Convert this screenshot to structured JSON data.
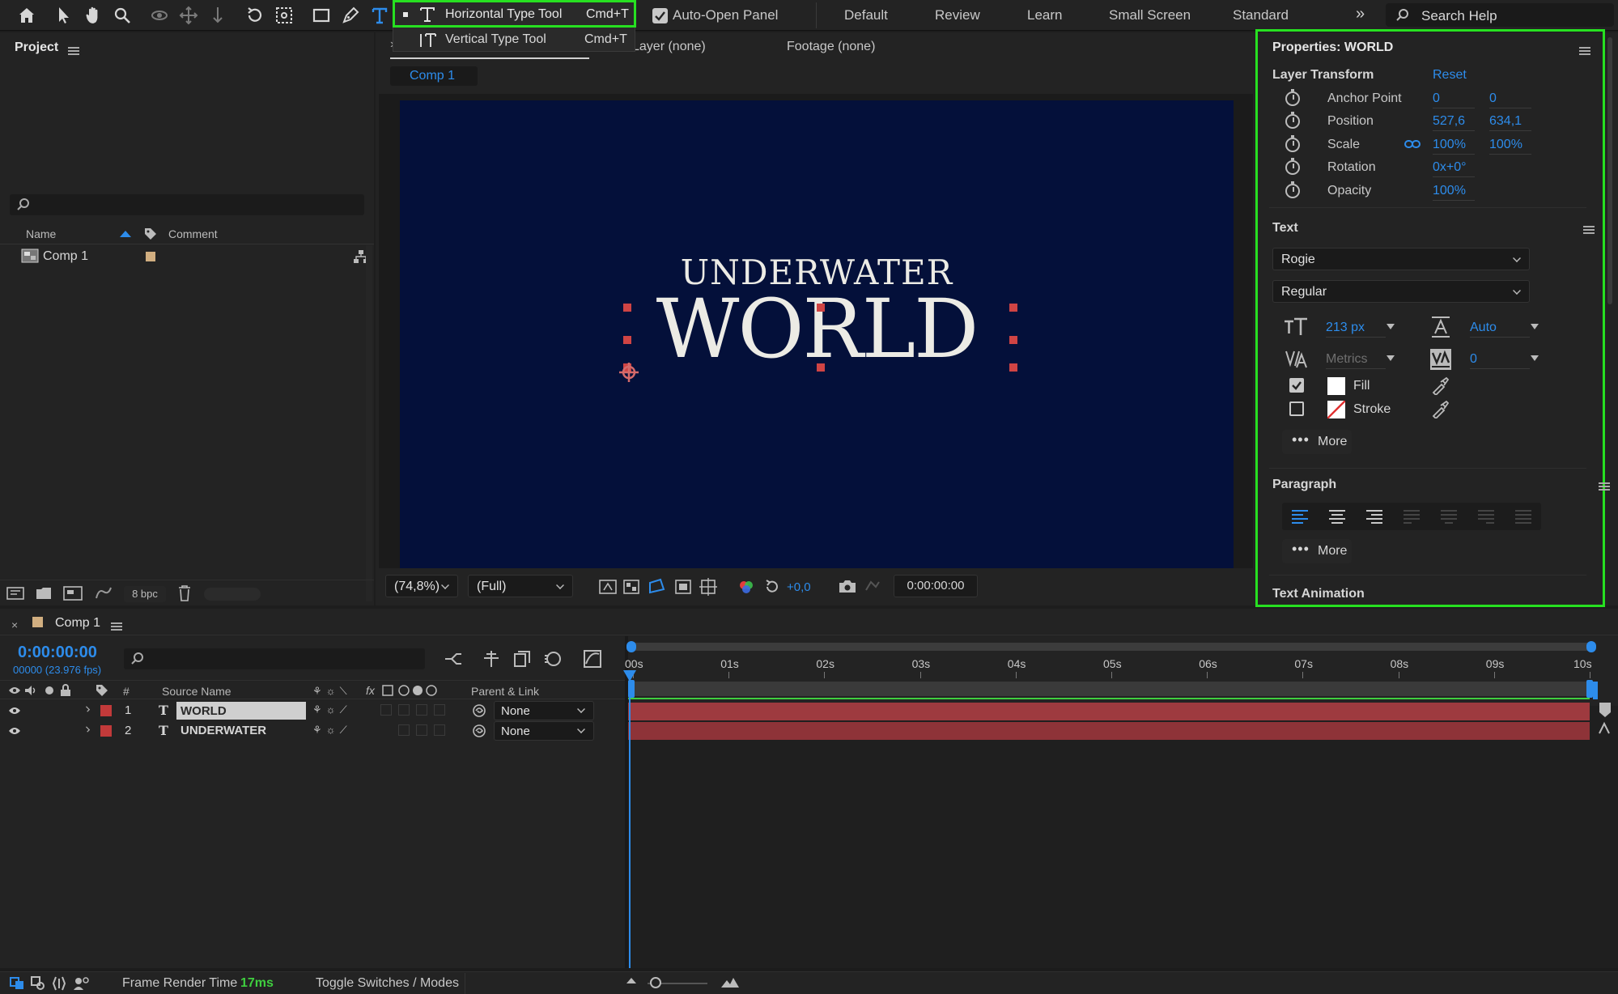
{
  "toolbar": {
    "tools": [
      "home-icon",
      "selection-icon",
      "hand-icon",
      "zoom-icon",
      "orbit-icon",
      "pan-icon",
      "dolly-icon",
      "rotate-icon",
      "anchor-icon",
      "rectangle-icon",
      "pen-icon",
      "type-icon"
    ],
    "auto_open_label": "Auto-Open Panel",
    "workspaces": [
      "Default",
      "Review",
      "Learn",
      "Small Screen",
      "Standard"
    ],
    "search_placeholder": "Search Help"
  },
  "type_menu": {
    "horizontal_label": "Horizontal Type Tool",
    "horizontal_shortcut": "Cmd+T",
    "vertical_label": "Vertical Type Tool",
    "vertical_shortcut": "Cmd+T"
  },
  "project": {
    "title": "Project",
    "col_name": "Name",
    "col_comment": "Comment",
    "items": [
      {
        "name": "Comp 1"
      }
    ],
    "bpc_label": "8 bpc"
  },
  "viewer": {
    "tab_layer": "Layer (none)",
    "tab_footage": "Footage (none)",
    "comp_tab": "Comp 1",
    "canvas_line1": "UNDERWATER",
    "canvas_line2": "WORLD",
    "zoom": "(74,8%)",
    "resolution": "(Full)",
    "exposure": "+0,0",
    "timecode": "0:00:00:00"
  },
  "properties": {
    "title": "Properties: WORLD",
    "layer_transform": "Layer Transform",
    "reset": "Reset",
    "rows": [
      {
        "label": "Anchor Point",
        "v1": "0",
        "v2": "0"
      },
      {
        "label": "Position",
        "v1": "527,6",
        "v2": "634,1"
      },
      {
        "label": "Scale",
        "v1": "100%",
        "v2": "100%"
      },
      {
        "label": "Rotation",
        "v1": "0x+0°",
        "v2": ""
      },
      {
        "label": "Opacity",
        "v1": "100%",
        "v2": ""
      }
    ],
    "text_section": "Text",
    "font_family": "Rogie",
    "font_style": "Regular",
    "font_size": "213 px",
    "leading": "Auto",
    "kerning": "Metrics",
    "tracking": "0",
    "fill_label": "Fill",
    "stroke_label": "Stroke",
    "more_label": "More",
    "paragraph_section": "Paragraph",
    "para_more_label": "More",
    "text_animation": "Text Animation"
  },
  "timeline": {
    "comp_name": "Comp 1",
    "timecode": "0:00:00:00",
    "fps": "00000 (23.976 fps)",
    "col_hash": "#",
    "col_source": "Source Name",
    "col_parent": "Parent & Link",
    "layers": [
      {
        "num": "1",
        "name": "WORLD",
        "parent": "None"
      },
      {
        "num": "2",
        "name": "UNDERWATER",
        "parent": "None"
      }
    ],
    "ruler": [
      "00s",
      "01s",
      "02s",
      "03s",
      "04s",
      "05s",
      "06s",
      "07s",
      "08s",
      "09s",
      "10s"
    ],
    "frame_render_label": "Frame Render Time",
    "frame_render_value": "17ms",
    "toggle_label": "Toggle Switches / Modes"
  },
  "colors": {
    "accent": "#2d8ceb",
    "highlight": "#27e021",
    "canvas_bg": "#04103a",
    "layer_label": "#c23a3a",
    "layer_bar": "#9e3a3f"
  }
}
